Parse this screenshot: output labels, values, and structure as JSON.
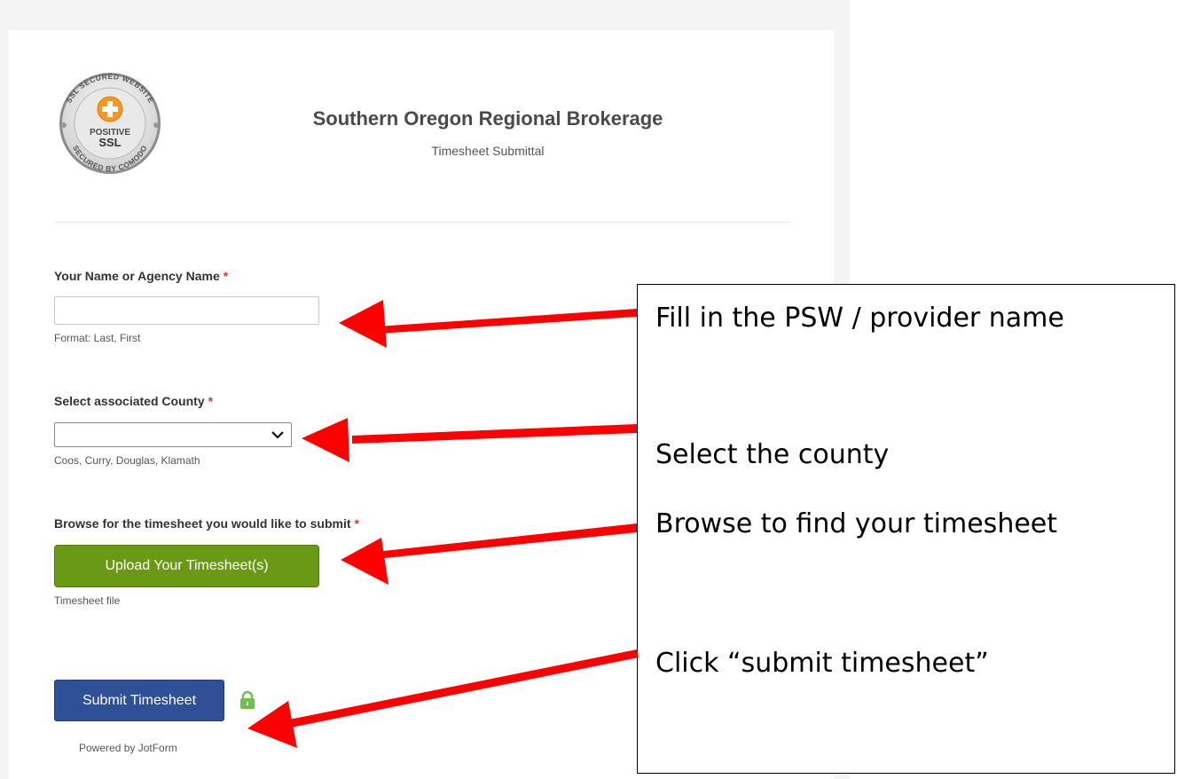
{
  "seal": {
    "ring_top": "SSL SECURED WEBSITE",
    "ring_left": "POSITIVE",
    "ring_bottom": "SECURED BY COMODO",
    "center_line1": "POSITIVE",
    "center_line2": "SSL",
    "accent_color": "#f39a1e"
  },
  "header": {
    "title": "Southern Oregon Regional Brokerage",
    "subtitle": "Timesheet Submittal"
  },
  "fields": {
    "name": {
      "label": "Your Name or Agency Name",
      "required_mark": "*",
      "value": "",
      "sublabel": "Format: Last, First"
    },
    "county": {
      "label": "Select associated County",
      "required_mark": "*",
      "selected": "",
      "sublabel": "Coos, Curry, Douglas, Klamath"
    },
    "timesheet": {
      "label": "Browse for the timesheet you would like to submit",
      "required_mark": "*",
      "button_label": "Upload Your Timesheet(s)",
      "sublabel": "Timesheet file"
    }
  },
  "submit": {
    "label": "Submit Timesheet",
    "icon": "lock-icon"
  },
  "footer": {
    "powered_by": "Powered by JotForm"
  },
  "annotations": {
    "items": [
      "Fill in the PSW / provider name",
      "Select the county",
      "Browse to find your timesheet",
      "Click “submit timesheet”"
    ],
    "arrow_color": "#ff0000"
  },
  "colors": {
    "upload_button": "#6a9a15",
    "submit_button": "#2f4f96",
    "required": "#e3342f"
  }
}
